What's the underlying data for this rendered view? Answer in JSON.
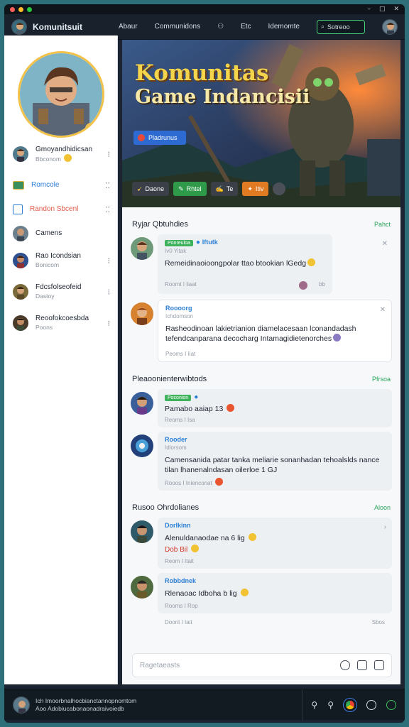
{
  "titlebar": {
    "controls": [
      "–",
      "□",
      "✕"
    ]
  },
  "topnav": {
    "brand": "Komunitsuit",
    "links": [
      "Abaur",
      "Communidons",
      "Etc",
      "Idemomte"
    ],
    "search_placeholder": "Sotreoo"
  },
  "sidebar": {
    "profile": {
      "name": "Gmoyandhidicsan",
      "sub": "Bbconom"
    },
    "items": [
      {
        "label": "Romcole",
        "color": "#2f7ed8",
        "icon": "chat-icon"
      },
      {
        "label": "Randon Sbcenl",
        "color": "#e05a47",
        "icon": "calendar-icon"
      },
      {
        "label": "Camens",
        "color": "#1d2330",
        "icon": "user-icon"
      },
      {
        "label": "Rao Icondsian",
        "sub": "Bonicom",
        "color": "#1d2330"
      },
      {
        "label": "Fdcsfolseofeid",
        "sub": "Dastoy",
        "color": "#1d2330"
      },
      {
        "label": "Reoofokcoesbda",
        "sub": "Poons",
        "color": "#1d2330"
      }
    ]
  },
  "hero": {
    "title_line1": "Komunitas",
    "title_line2": "Game Indancisii",
    "chip": "Pladrunus",
    "buttons": [
      {
        "label": "Daone",
        "color": "#3a3f48"
      },
      {
        "label": "Rhtel",
        "color": "#2f9a4a"
      },
      {
        "label": "Te",
        "color": "#3a3f48"
      },
      {
        "label": "Itiv",
        "color": "#e07a23"
      }
    ]
  },
  "sections": {
    "s1": {
      "title": "Ryjar Qbtuhdies",
      "link": "Pahct"
    },
    "s2": {
      "title": "Pleaoonienterwibtods",
      "link": "Pfrsoa"
    },
    "s3": {
      "title": "Rusoo Ohrdolianes",
      "link": "Aloon"
    }
  },
  "posts": {
    "p1": {
      "tag": "Ponreuloa",
      "name": "Iftutk",
      "sub": "Iv0 Yitak",
      "text": "Remeidinaoioongpolar ttao btookian lGedg",
      "meta": "Roomt  I liaat",
      "count": "bb"
    },
    "p2": {
      "name": "Roooorg",
      "sub": "Ichdomson",
      "text": "Rasheodinoan lakietrianion diamelacesaan lconandadash tefendcanparana decocharg Intamagidietenorches",
      "meta": "Peoms  I Iiat"
    },
    "p3": {
      "tag": "Poconion",
      "text": "Pamabo aaiap 13",
      "meta": "Reoms  I Isa"
    },
    "p4": {
      "name": "Rooder",
      "sub": "Idlorsom",
      "text": "Camensanida patar tanka meliarie sonanhadan tehoalslds nance tilan lhanenalndasan oilerloe 1 GJ",
      "meta": "Rooos  I Inienconat"
    },
    "p5": {
      "name": "Dorlkinn",
      "text": "Alenuldanaodae na 6 lig",
      "text2": "Dob Bil",
      "meta": "Reom  I Itait"
    },
    "p6": {
      "name": "Robbdnek",
      "text": "Rlenaoac Idboha b lig",
      "meta": "Rooms  I Rop"
    },
    "p7": {
      "meta": "Doont  I Iait",
      "count": "Sbos"
    }
  },
  "composer": {
    "placeholder": "Ragetaeasts"
  },
  "bottombar": {
    "line1": "Ich  Imoorbnalhocbianctannopnomtom",
    "line2": "Aoo  Adobiucabonaonadraivoiedb"
  },
  "colors": {
    "accent": "#27a45a",
    "link": "#2b7fd4",
    "dark": "#18212c"
  }
}
